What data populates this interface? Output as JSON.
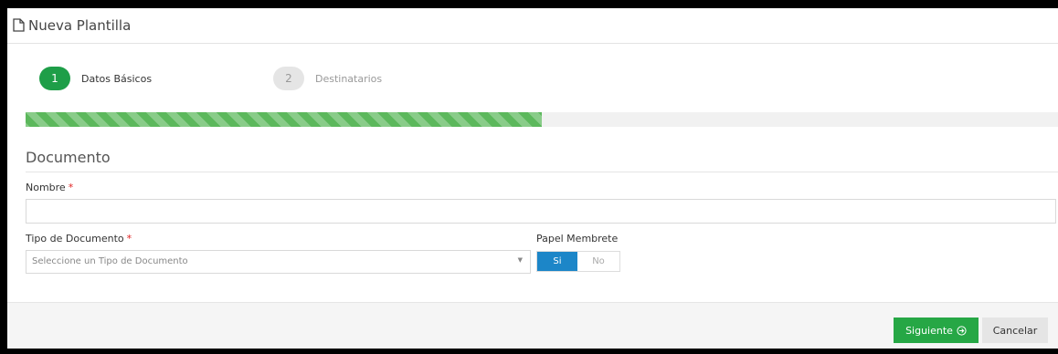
{
  "header": {
    "title": "Nueva Plantilla",
    "icon": "document-icon"
  },
  "wizard": {
    "steps": [
      {
        "number": "1",
        "label": "Datos Básicos",
        "state": "active"
      },
      {
        "number": "2",
        "label": "Destinatarios",
        "state": "inactive"
      }
    ],
    "progress_fraction": 0.5,
    "colors": {
      "active_step": "#1e9e48",
      "progress": "#5cb85c"
    }
  },
  "form": {
    "section_title": "Documento",
    "required_marker": "*",
    "nombre": {
      "label": "Nombre",
      "value": "",
      "placeholder": ""
    },
    "tipo_documento": {
      "label": "Tipo de Documento",
      "selected": "Seleccione un Tipo de Documento"
    },
    "papel_membrete": {
      "label": "Papel Membrete",
      "options": [
        "Si",
        "No"
      ],
      "selected": "Si",
      "active_color": "#1c86c8"
    }
  },
  "footer": {
    "next_label": "Siguiente",
    "next_icon": "arrow-circle-right-icon",
    "cancel_label": "Cancelar",
    "primary_color": "#26a745"
  }
}
